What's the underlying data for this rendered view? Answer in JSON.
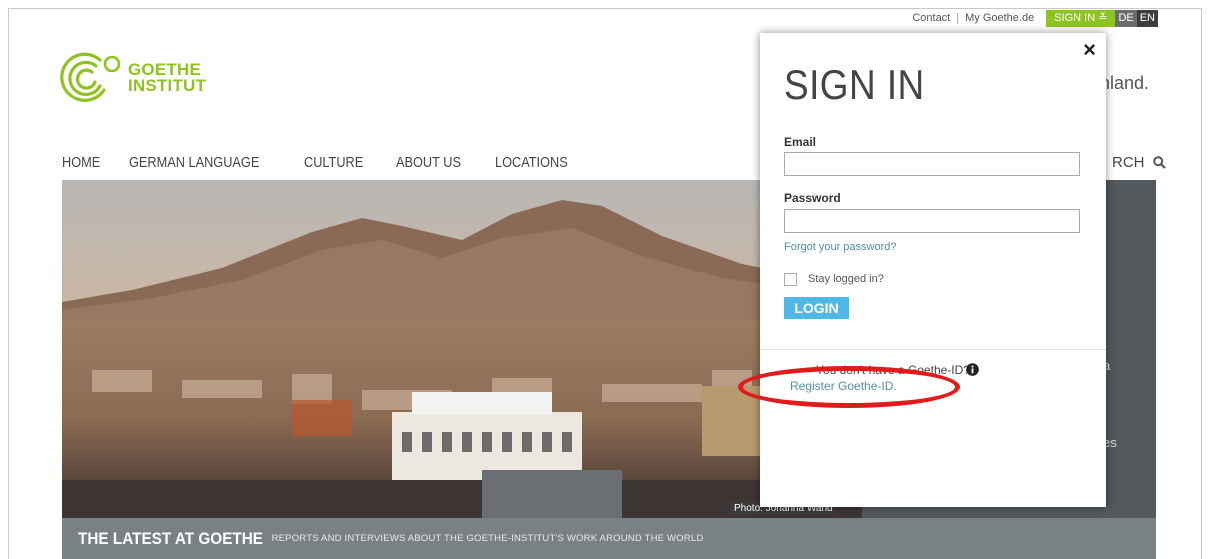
{
  "util": {
    "contact": "Contact",
    "sep": "|",
    "my_goethe": "My Goethe.de",
    "signin": "SIGN IN ≚",
    "lang_de": "DE",
    "lang_en": "EN"
  },
  "logo": {
    "line1": "GOETHE",
    "line2": "INSTITUT"
  },
  "tagline": "nland.",
  "nav": {
    "items": [
      {
        "label": "HOME"
      },
      {
        "label": "GERMAN LANGUAGE"
      },
      {
        "label": "CULTURE"
      },
      {
        "label": "ABOUT US"
      },
      {
        "label": "LOCATIONS"
      }
    ],
    "search_label": "RCH"
  },
  "hero": {
    "credit": "Photo: Johanna Wand",
    "side_fragments": [
      "a",
      "es"
    ]
  },
  "latest": {
    "title": "THE LATEST AT GOETHE",
    "subtitle": "REPORTS AND INTERVIEWS ABOUT THE GOETHE-INSTITUT'S WORK AROUND THE WORLD"
  },
  "modal": {
    "close": "×",
    "title": "SIGN IN",
    "email_label": "Email",
    "email_value": "",
    "password_label": "Password",
    "password_value": "",
    "forgot": "Forgot your password?",
    "stay_logged": "Stay logged in?",
    "login_button": "LOGIN",
    "no_id_text": "You don't have a Goethe-ID?",
    "register": "Register Goethe-ID."
  },
  "colors": {
    "brand_green": "#8fc31f",
    "login_blue": "#4fb8e6",
    "link_teal": "#4e8fa8",
    "highlight_red": "#e11b1b"
  }
}
